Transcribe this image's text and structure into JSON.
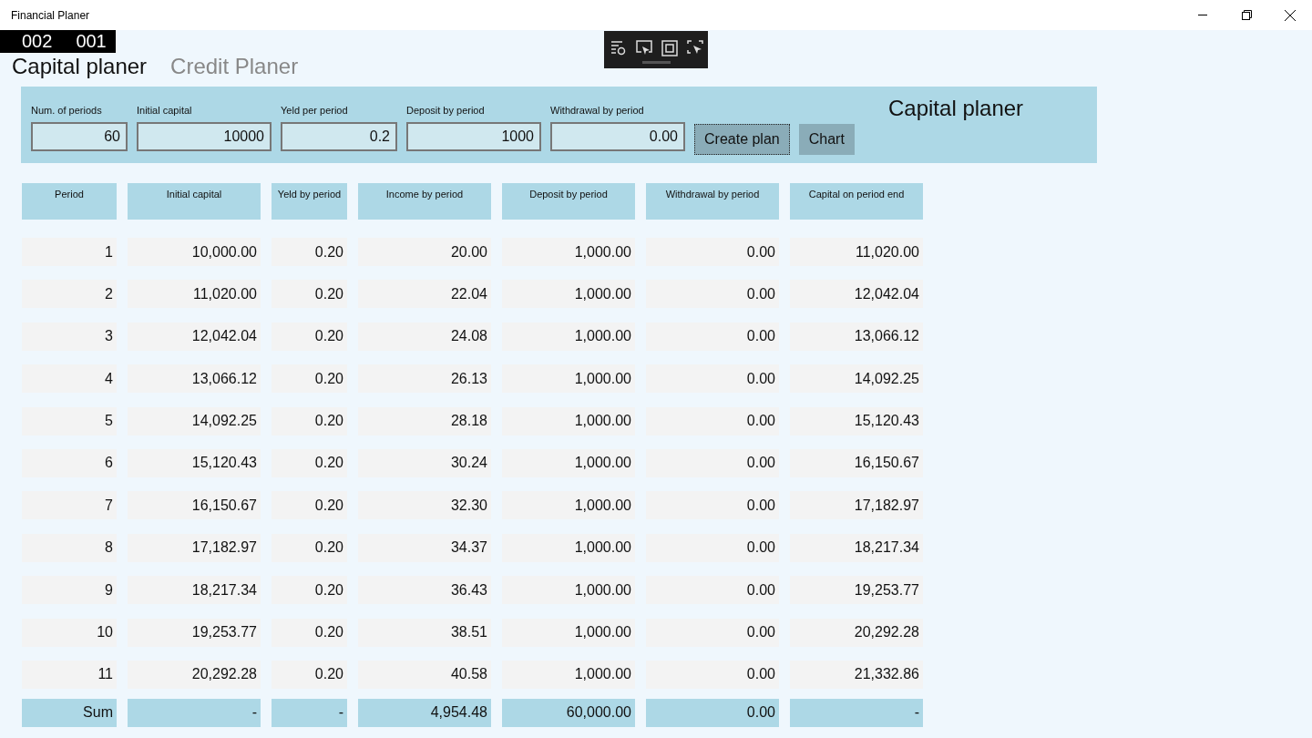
{
  "window": {
    "title": "Financial Planer"
  },
  "debug_counter": [
    "002",
    "001"
  ],
  "tabs": [
    {
      "label": "Capital planer",
      "selected": true
    },
    {
      "label": "Credit Planer",
      "selected": false
    }
  ],
  "form": {
    "title": "Capital planer",
    "fields": [
      {
        "label": "Num. of periods",
        "value": "60"
      },
      {
        "label": "Initial capital",
        "value": "10000"
      },
      {
        "label": "Yeld per period",
        "value": "0.2"
      },
      {
        "label": "Deposit by period",
        "value": "1000"
      },
      {
        "label": "Withdrawal by period",
        "value": "0.00"
      }
    ],
    "buttons": [
      {
        "label": "Create plan",
        "focused": true
      },
      {
        "label": "Chart",
        "focused": false
      }
    ]
  },
  "table": {
    "columns": [
      "Period",
      "Initial capital",
      "Yeld by period",
      "Income by period",
      "Deposit by period",
      "Withdrawal by period",
      "Capital on period end"
    ],
    "rows": [
      [
        "1",
        "10,000.00",
        "0.20",
        "20.00",
        "1,000.00",
        "0.00",
        "11,020.00"
      ],
      [
        "2",
        "11,020.00",
        "0.20",
        "22.04",
        "1,000.00",
        "0.00",
        "12,042.04"
      ],
      [
        "3",
        "12,042.04",
        "0.20",
        "24.08",
        "1,000.00",
        "0.00",
        "13,066.12"
      ],
      [
        "4",
        "13,066.12",
        "0.20",
        "26.13",
        "1,000.00",
        "0.00",
        "14,092.25"
      ],
      [
        "5",
        "14,092.25",
        "0.20",
        "28.18",
        "1,000.00",
        "0.00",
        "15,120.43"
      ],
      [
        "6",
        "15,120.43",
        "0.20",
        "30.24",
        "1,000.00",
        "0.00",
        "16,150.67"
      ],
      [
        "7",
        "16,150.67",
        "0.20",
        "32.30",
        "1,000.00",
        "0.00",
        "17,182.97"
      ],
      [
        "8",
        "17,182.97",
        "0.20",
        "34.37",
        "1,000.00",
        "0.00",
        "18,217.34"
      ],
      [
        "9",
        "18,217.34",
        "0.20",
        "36.43",
        "1,000.00",
        "0.00",
        "19,253.77"
      ],
      [
        "10",
        "19,253.77",
        "0.20",
        "38.51",
        "1,000.00",
        "0.00",
        "20,292.28"
      ],
      [
        "11",
        "20,292.28",
        "0.20",
        "40.58",
        "1,000.00",
        "0.00",
        "21,332.86"
      ]
    ],
    "sum": [
      "Sum",
      "-",
      "-",
      "4,954.48",
      "60,000.00",
      "0.00",
      "-"
    ]
  }
}
